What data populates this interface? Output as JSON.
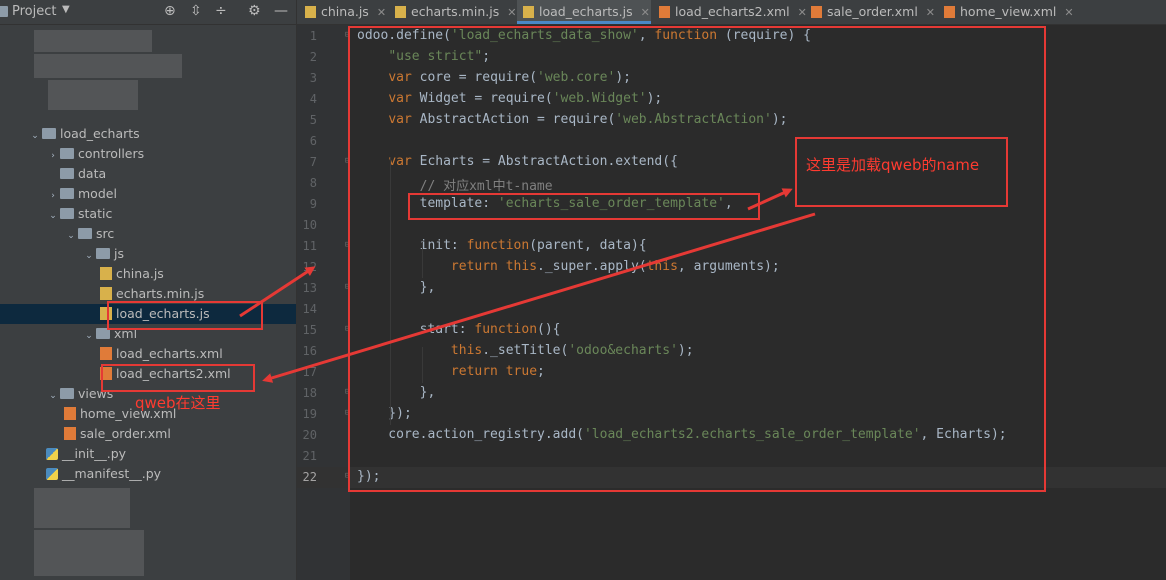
{
  "project_panel": {
    "title": "Project",
    "tree": [
      {
        "label": "load_echarts",
        "kind": "folder-package",
        "expanded": true
      },
      {
        "label": "controllers",
        "kind": "folder",
        "expanded": false
      },
      {
        "label": "data",
        "kind": "folder",
        "expanded": null
      },
      {
        "label": "model",
        "kind": "folder",
        "expanded": false
      },
      {
        "label": "static",
        "kind": "folder",
        "expanded": true
      },
      {
        "label": "src",
        "kind": "folder",
        "expanded": true
      },
      {
        "label": "js",
        "kind": "folder",
        "expanded": true
      },
      {
        "label": "china.js",
        "kind": "js-file"
      },
      {
        "label": "echarts.min.js",
        "kind": "js-file"
      },
      {
        "label": "load_echarts.js",
        "kind": "js-file",
        "selected": true
      },
      {
        "label": "xml",
        "kind": "folder",
        "expanded": true
      },
      {
        "label": "load_echarts.xml",
        "kind": "xml-file"
      },
      {
        "label": "load_echarts2.xml",
        "kind": "xml-file"
      },
      {
        "label": "views",
        "kind": "folder",
        "expanded": true
      },
      {
        "label": "home_view.xml",
        "kind": "xml-file"
      },
      {
        "label": "sale_order.xml",
        "kind": "xml-file"
      },
      {
        "label": "__init__.py",
        "kind": "py-file"
      },
      {
        "label": "__manifest__.py",
        "kind": "py-file"
      }
    ]
  },
  "tabs": [
    {
      "label": "china.js",
      "kind": "js-file"
    },
    {
      "label": "echarts.min.js",
      "kind": "js-file"
    },
    {
      "label": "load_echarts.js",
      "kind": "js-file",
      "active": true
    },
    {
      "label": "load_echarts2.xml",
      "kind": "xml-file"
    },
    {
      "label": "sale_order.xml",
      "kind": "xml-file"
    },
    {
      "label": "home_view.xml",
      "kind": "xml-file"
    }
  ],
  "editor": {
    "current_line": 22,
    "lines": [
      [
        [
          "plain",
          "odoo.define("
        ],
        [
          "str",
          "'load_echarts_data_show'"
        ],
        [
          "plain",
          ", "
        ],
        [
          "kw",
          "function"
        ],
        [
          "plain",
          " (require) {"
        ]
      ],
      [
        [
          "plain",
          "    "
        ],
        [
          "str",
          "\"use strict\""
        ],
        [
          "plain",
          ";"
        ]
      ],
      [
        [
          "plain",
          "    "
        ],
        [
          "kw",
          "var"
        ],
        [
          "plain",
          " core = require("
        ],
        [
          "str",
          "'web.core'"
        ],
        [
          "plain",
          ");"
        ]
      ],
      [
        [
          "plain",
          "    "
        ],
        [
          "kw",
          "var"
        ],
        [
          "plain",
          " Widget = require("
        ],
        [
          "str",
          "'web.Widget'"
        ],
        [
          "plain",
          ");"
        ]
      ],
      [
        [
          "plain",
          "    "
        ],
        [
          "kw",
          "var"
        ],
        [
          "plain",
          " AbstractAction = require("
        ],
        [
          "str",
          "'web.AbstractAction'"
        ],
        [
          "plain",
          ");"
        ]
      ],
      [],
      [
        [
          "plain",
          "    "
        ],
        [
          "kw",
          "var"
        ],
        [
          "plain",
          " Echarts = AbstractAction.extend({"
        ]
      ],
      [
        [
          "plain",
          "        "
        ],
        [
          "cmt",
          "// 对应xml中t-name"
        ]
      ],
      [
        [
          "plain",
          "        template: "
        ],
        [
          "str",
          "'echarts_sale_order_template'"
        ],
        [
          "plain",
          ","
        ]
      ],
      [],
      [
        [
          "plain",
          "        init: "
        ],
        [
          "kw",
          "function"
        ],
        [
          "plain",
          "(parent, data){"
        ]
      ],
      [
        [
          "plain",
          "            "
        ],
        [
          "kw",
          "return"
        ],
        [
          "plain",
          " "
        ],
        [
          "kw",
          "this"
        ],
        [
          "plain",
          "._super.apply("
        ],
        [
          "kw",
          "this"
        ],
        [
          "plain",
          ", arguments);"
        ]
      ],
      [
        [
          "plain",
          "        },"
        ]
      ],
      [],
      [
        [
          "plain",
          "        start: "
        ],
        [
          "kw",
          "function"
        ],
        [
          "plain",
          "(){"
        ]
      ],
      [
        [
          "plain",
          "            "
        ],
        [
          "kw",
          "this"
        ],
        [
          "plain",
          "._setTitle("
        ],
        [
          "str",
          "'odoo&echarts'"
        ],
        [
          "plain",
          ");"
        ]
      ],
      [
        [
          "plain",
          "            "
        ],
        [
          "kw",
          "return"
        ],
        [
          "plain",
          " "
        ],
        [
          "kw",
          "true"
        ],
        [
          "plain",
          ";"
        ]
      ],
      [
        [
          "plain",
          "        },"
        ]
      ],
      [
        [
          "plain",
          "    });"
        ]
      ],
      [
        [
          "plain",
          "    core.action_registry.add("
        ],
        [
          "str",
          "'load_echarts2.echarts_sale_order_template'"
        ],
        [
          "plain",
          ", Echarts);"
        ]
      ],
      [],
      [
        [
          "plain",
          "});"
        ]
      ]
    ]
  },
  "annotations": {
    "name_note": "这里是加载qweb的name",
    "qweb_note": "qweb在这里"
  },
  "colors": {
    "annotation_red": "#e53935",
    "keyword": "#cc7832",
    "string": "#6a8759",
    "comment": "#808080",
    "plain": "#a9b7c6"
  }
}
